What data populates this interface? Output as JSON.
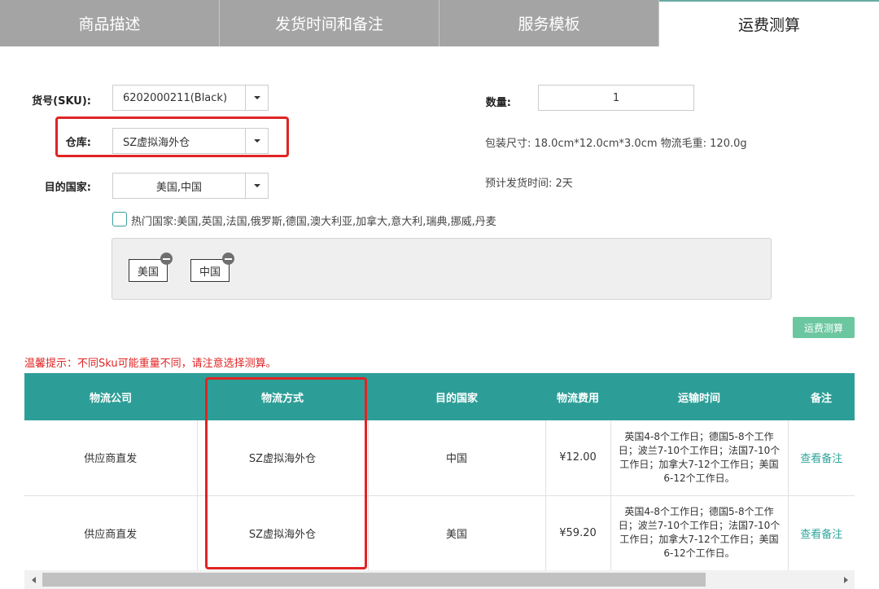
{
  "tabs": [
    "商品描述",
    "发货时间和备注",
    "服务模板",
    "运费测算"
  ],
  "form": {
    "sku_label": "货号(SKU):",
    "sku_value": "6202000211(Black)",
    "warehouse_label": "仓库:",
    "warehouse_value": "SZ虚拟海外仓",
    "country_label": "目的国家:",
    "country_value": "美国,中国",
    "qty_label": "数量:",
    "qty_value": "1",
    "package": "包装尺寸:  18.0cm*12.0cm*3.0cm    物流毛重:  120.0g",
    "ship_time": "预计发货时间:  2天",
    "hot_countries": "热门国家:美国,英国,法国,俄罗斯,德国,澳大利亚,加拿大,意大利,瑞典,挪威,丹麦",
    "chips": [
      "美国",
      "中国"
    ],
    "calc_button": "运费测算"
  },
  "tip": "温馨提示：不同Sku可能重量不同，请注意选择测算。",
  "table": {
    "headers": [
      "物流公司",
      "物流方式",
      "目的国家",
      "物流费用",
      "运输时间",
      "备注"
    ],
    "rows": [
      [
        "供应商直发",
        "SZ虚拟海外仓",
        "中国",
        "¥12.00",
        "英国4-8个工作日；德国5-8个工作日；波兰7-10个工作日；法国7-10个工作日；加拿大7-12个工作日；美国6-12个工作日。",
        "查看备注"
      ],
      [
        "供应商直发",
        "SZ虚拟海外仓",
        "美国",
        "¥59.20",
        "英国4-8个工作日；德国5-8个工作日；波兰7-10个工作日；法国7-10个工作日；加拿大7-12个工作日；美国6-12个工作日。",
        "查看备注"
      ]
    ]
  },
  "colors": {
    "accent": "#2d9e97",
    "highlight": "#e02424",
    "button": "#6cc7a0"
  }
}
